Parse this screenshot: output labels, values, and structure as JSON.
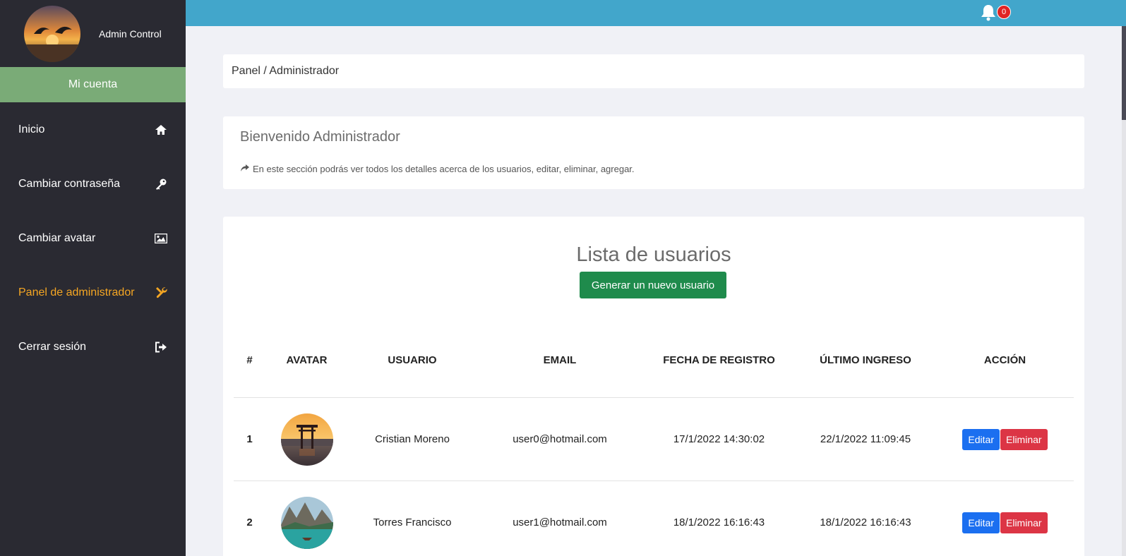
{
  "sidebar": {
    "profile_name": "Admin Control",
    "account_label": "Mi cuenta",
    "items": [
      {
        "label": "Inicio",
        "icon": "home-icon"
      },
      {
        "label": "Cambiar contraseña",
        "icon": "key-icon"
      },
      {
        "label": "Cambiar avatar",
        "icon": "image-icon"
      },
      {
        "label": "Panel de administrador",
        "icon": "tools-icon",
        "active": true
      },
      {
        "label": "Cerrar sesión",
        "icon": "sign-out-icon"
      }
    ],
    "active_color": "#f5a623"
  },
  "topbar": {
    "color": "#42a6cb",
    "notifications_count": "0"
  },
  "breadcrumb": "Panel / Administrador",
  "welcome": {
    "title": "Bienvenido Administrador",
    "description": "En este sección podrás ver todos los detalles acerca de los usuarios, editar, eliminar, agregar."
  },
  "users": {
    "title": "Lista de usuarios",
    "new_user_button": "Generar un nuevo usuario",
    "columns": [
      "#",
      "AVATAR",
      "USUARIO",
      "EMAIL",
      "FECHA DE REGISTRO",
      "ÚLTIMO INGRESO",
      "ACCIÓN"
    ],
    "rows": [
      {
        "num": "1",
        "user": "Cristian Moreno",
        "email": "user0@hotmail.com",
        "registered": "17/1/2022 14:30:02",
        "last_login": "22/1/2022 11:09:45",
        "edit": "Editar",
        "delete": "Eliminar"
      },
      {
        "num": "2",
        "user": "Torres Francisco",
        "email": "user1@hotmail.com",
        "registered": "18/1/2022 16:16:43",
        "last_login": "18/1/2022 16:16:43",
        "edit": "Editar",
        "delete": "Eliminar"
      }
    ]
  }
}
